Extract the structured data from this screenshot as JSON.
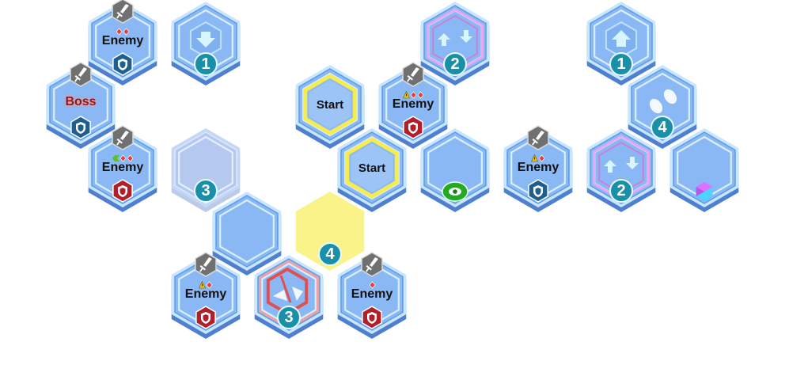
{
  "tiles": [
    {
      "id": "t1",
      "kind": "enemy",
      "label": "Enemy",
      "shield": "blue",
      "marks": "dd"
    },
    {
      "id": "t2",
      "kind": "arrow-down",
      "num": "1"
    },
    {
      "id": "t3",
      "kind": "enemy",
      "label": "Boss",
      "boss": true,
      "shield": "blue"
    },
    {
      "id": "t4",
      "kind": "enemy",
      "label": "Enemy",
      "shield": "red",
      "marks": "gdd"
    },
    {
      "id": "t5",
      "kind": "faded",
      "num": "3"
    },
    {
      "id": "t6",
      "kind": "plain"
    },
    {
      "id": "t7",
      "kind": "enemy",
      "label": "Enemy",
      "shield": "red",
      "marks": "wd"
    },
    {
      "id": "t8",
      "kind": "broken",
      "num": "3"
    },
    {
      "id": "t9",
      "kind": "yellow",
      "num": "4"
    },
    {
      "id": "t10",
      "kind": "enemy",
      "label": "Enemy",
      "shield": "red",
      "marks": "s"
    },
    {
      "id": "t11",
      "kind": "start",
      "label": "Start"
    },
    {
      "id": "t12",
      "kind": "start",
      "label": "Start"
    },
    {
      "id": "t13",
      "kind": "swap",
      "num": "2"
    },
    {
      "id": "t14",
      "kind": "enemy",
      "label": "Enemy",
      "shield": "red",
      "marks": "wdd"
    },
    {
      "id": "t15",
      "kind": "eye"
    },
    {
      "id": "t16",
      "kind": "enemy",
      "label": "Enemy",
      "shield": "blue",
      "marks": "wd"
    },
    {
      "id": "t17",
      "kind": "arrow-up",
      "num": "1"
    },
    {
      "id": "t18",
      "kind": "steps",
      "num": "4"
    },
    {
      "id": "t19",
      "kind": "swap",
      "num": "2"
    },
    {
      "id": "t20",
      "kind": "gem"
    }
  ],
  "colors": {
    "tile_fill": "#8ab8f5",
    "tile_rim": "#c8e6ff",
    "tile_side": "#4f7fcf",
    "shield_red": "#b01f2a",
    "shield_blue": "#1f5f8f",
    "num_bg": "#1a8fa8",
    "start_ring": "#f7ec4d",
    "swap_ring": "#e8a6f0",
    "yellow": "#faf38a"
  }
}
